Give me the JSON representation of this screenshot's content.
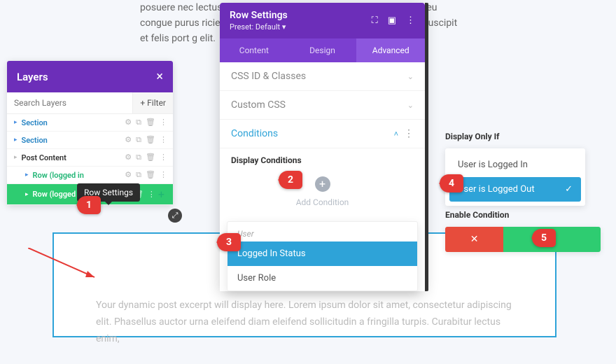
{
  "bg_text": "posuere nec lectus s                                                               ac fermentum accumsa                                                              in dictum auctor mi, eu congue                                                                purus                                       ricies vel po                                                                      , varius                                       tum est ut,                                                                        finibus,                                       uris pulvina                                                                       suscipit                                       et felis port                                                                                                                g elit.",
  "layers": {
    "title": "Layers",
    "search_placeholder": "Search Layers",
    "filter_btn": "+  Filter",
    "rows": [
      {
        "label": "Section",
        "indent": false
      },
      {
        "label": "Section",
        "indent": false
      },
      {
        "label": "Post Content",
        "indent": false,
        "black": true
      },
      {
        "label": "Row (logged in",
        "indent": true
      },
      {
        "label": "Row (logged o",
        "indent": true,
        "active": true
      }
    ],
    "tooltip": "Row Settings"
  },
  "modal": {
    "title": "Row Settings",
    "preset": "Preset: Default ▾",
    "tabs": [
      "Content",
      "Design",
      "Advanced"
    ],
    "active_tab": 2,
    "acc": {
      "css_id": "CSS ID & Classes",
      "custom_css": "Custom CSS",
      "conditions": "Conditions"
    },
    "display_conditions_label": "Display Conditions",
    "add_condition": "Add Condition",
    "dropdown": {
      "group": "User",
      "items": [
        "Logged In Status",
        "User Role"
      ],
      "selected": 0
    }
  },
  "display_if": {
    "label": "Display Only If",
    "opt_logged_in": "User is Logged In",
    "opt_logged_out": "User is Logged Out"
  },
  "enable": {
    "label": "Enable Condition"
  },
  "preview": "Your dynamic post excerpt will display here. Lorem ipsum dolor sit amet, consectetur adipiscing elit. Phasellus auctor urna eleifend diam eleifend sollicitudin a fringilla turpis. Curabitur lectus enim,",
  "badges": {
    "b1": "1",
    "b2": "2",
    "b3": "3",
    "b4": "4",
    "b5": "5"
  },
  "icons": {
    "gear": "⚙",
    "copy": "⧉",
    "trash": "🗑",
    "more": "⋮",
    "caret": "▸",
    "chev_down": "⌄",
    "chev_up": "˄",
    "plus": "+",
    "check": "✓",
    "x": "✕",
    "expand": "⛶",
    "tablet": "▣"
  }
}
